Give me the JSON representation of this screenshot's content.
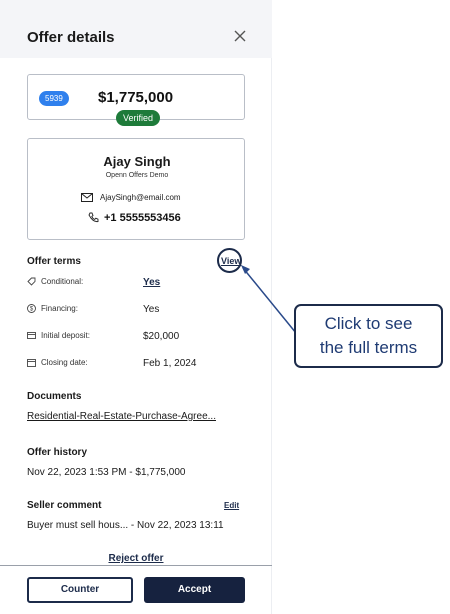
{
  "header": {
    "title": "Offer details",
    "close_icon": "close-icon"
  },
  "offer": {
    "id": "5939",
    "price": "$1,775,000",
    "status": "Verified"
  },
  "contact": {
    "name": "Ajay Singh",
    "organization": "Openn Offers Demo",
    "email": "AjaySingh@email.com",
    "phone": "+1 5555553456"
  },
  "terms": {
    "heading": "Offer terms",
    "view_label": "View",
    "rows": [
      {
        "icon": "tag-icon",
        "label": "Conditional:",
        "value": "Yes"
      },
      {
        "icon": "dollar-icon",
        "label": "Financing:",
        "value": "Yes"
      },
      {
        "icon": "card-icon",
        "label": "Initial deposit:",
        "value": "$20,000"
      },
      {
        "icon": "calendar-icon",
        "label": "Closing date:",
        "value": "Feb 1, 2024"
      }
    ]
  },
  "documents": {
    "heading": "Documents",
    "file": "Residential-Real-Estate-Purchase-Agree..."
  },
  "history": {
    "heading": "Offer history",
    "entry": "Nov 22, 2023 1:53 PM - $1,775,000"
  },
  "comment": {
    "heading": "Seller comment",
    "edit_label": "Edit",
    "text": "Buyer must sell hous...  - Nov 22, 2023 13:11"
  },
  "actions": {
    "reject_label": "Reject offer",
    "counter_label": "Counter",
    "accept_label": "Accept"
  },
  "annotation": {
    "line1": "Click to see",
    "line2": "the full terms"
  },
  "colors": {
    "navy": "#1c2b4a",
    "badge_blue": "#2f80ed",
    "verified_green": "#1e7b3a",
    "callout_text": "#1f3b73"
  }
}
